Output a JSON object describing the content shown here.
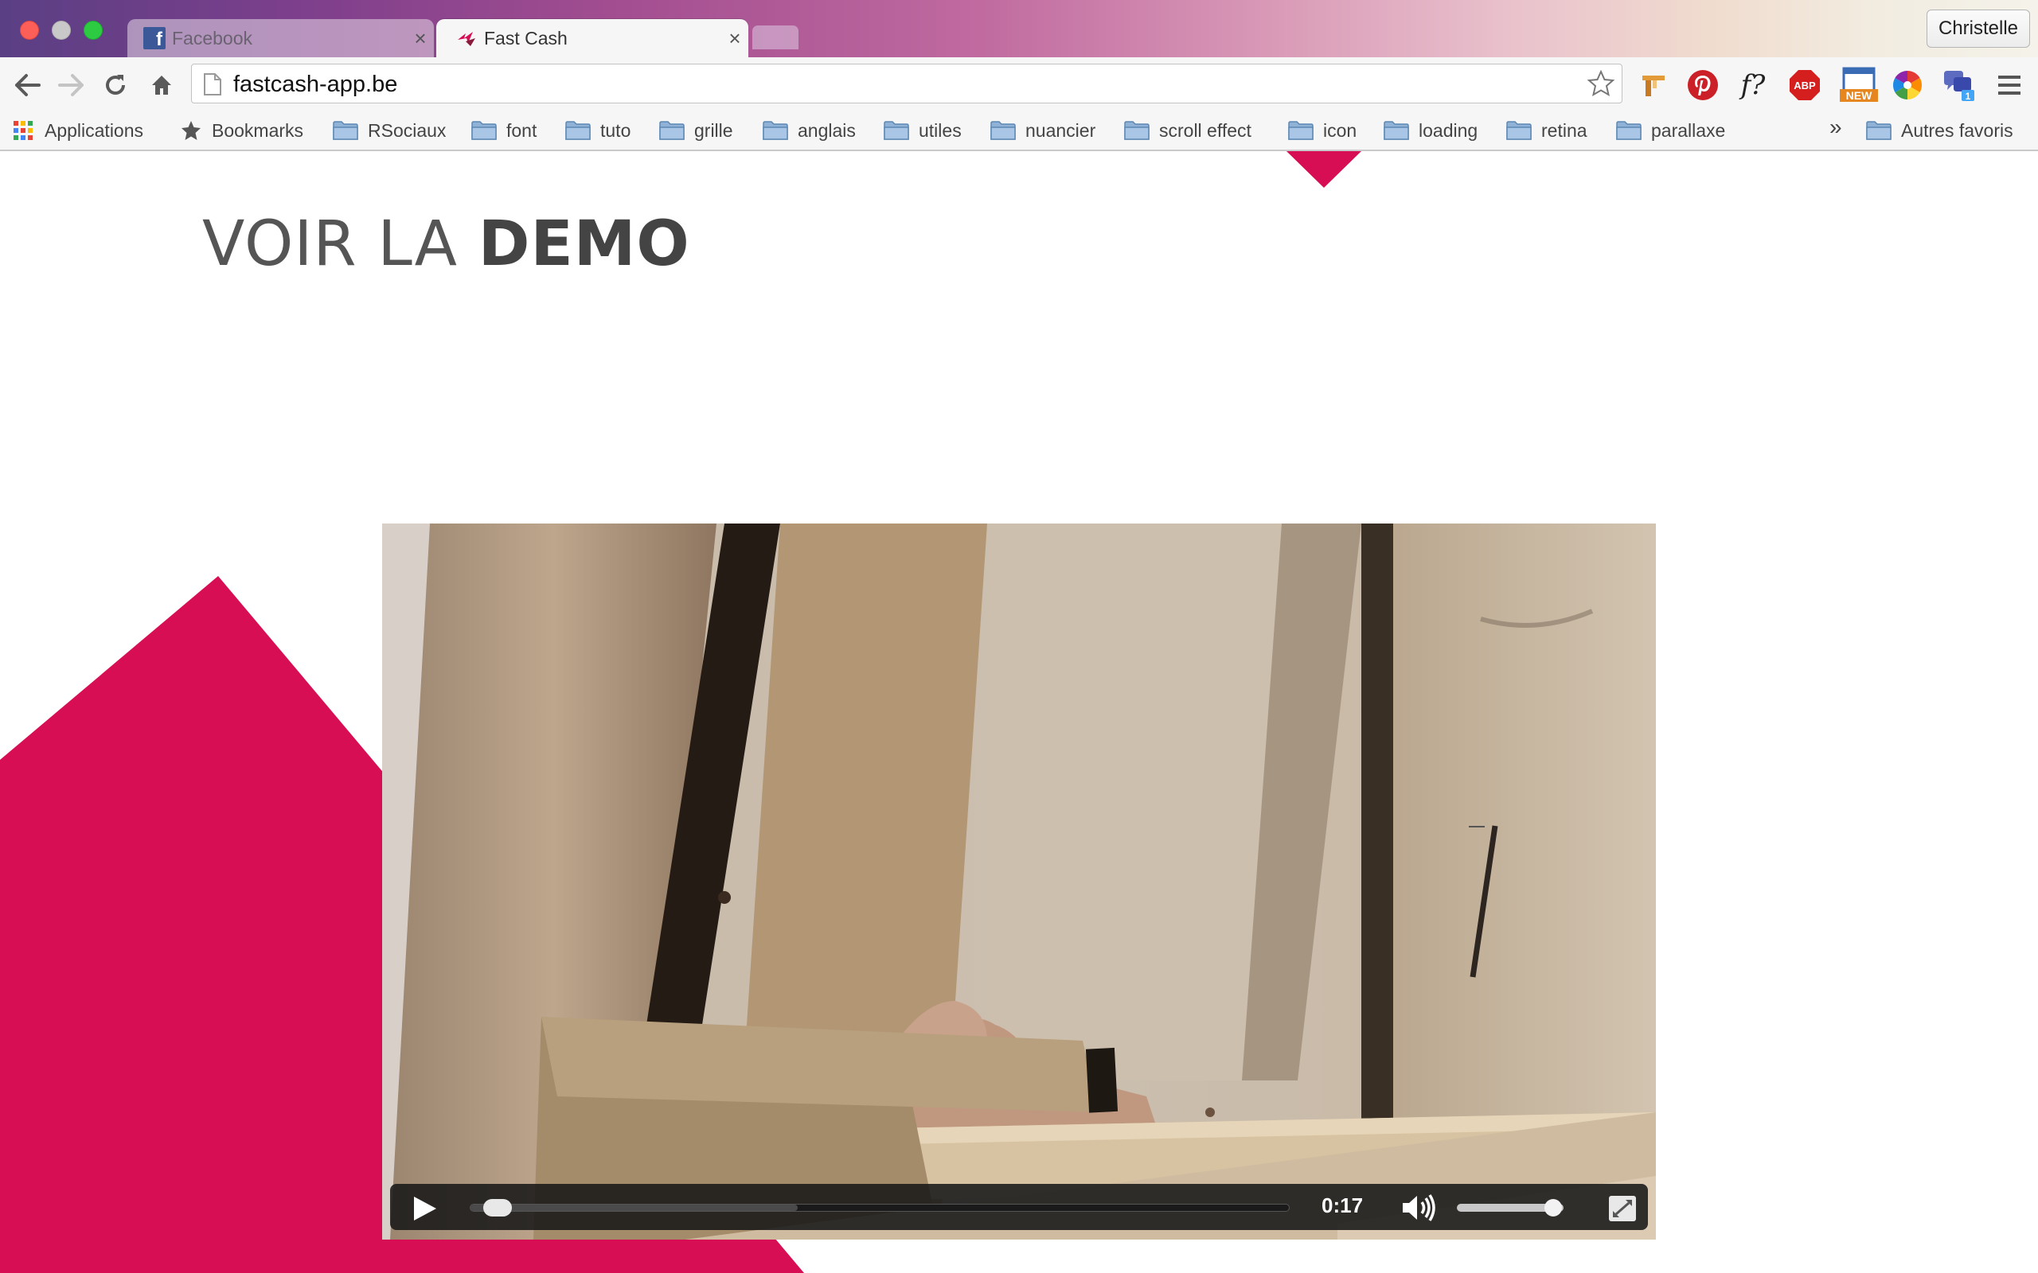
{
  "window": {
    "traffic_lights": [
      "close",
      "minimize",
      "zoom"
    ],
    "profile_name": "Christelle"
  },
  "tabs": [
    {
      "title": "Facebook",
      "icon": "facebook-icon",
      "close": "×",
      "active": false
    },
    {
      "title": "Fast Cash",
      "icon": "fastcash-logo-icon",
      "close": "×",
      "active": true
    }
  ],
  "toolbar": {
    "url": "fastcash-app.be",
    "nav_icons": [
      "back-arrow-icon",
      "forward-arrow-icon",
      "reload-icon",
      "home-icon"
    ],
    "extensions": [
      "bookmark-manager-icon",
      "pinterest-icon",
      "whatfont-icon",
      "adblock-plus-icon",
      "new-tab-extension-icon",
      "color-picker-icon",
      "translate-extension-icon",
      "chrome-menu-icon"
    ],
    "whatfont_label": "f?",
    "abp_label": "ABP",
    "new_label": "NEW",
    "translate_badge": "1"
  },
  "bookmarks": {
    "apps_label": "Applications",
    "bookmarks_label": "Bookmarks",
    "folders": [
      "RSociaux",
      "font",
      "tuto",
      "grille",
      "anglais",
      "utiles",
      "nuancier",
      "scroll effect",
      "icon",
      "loading",
      "retina",
      "parallaxe"
    ],
    "overflow": "»",
    "other": "Autres favoris"
  },
  "page": {
    "heading_light": "VOIR LA ",
    "heading_bold": "DEMO",
    "accent_color": "#d80e55"
  },
  "video": {
    "current_time": "0:17",
    "progress_fraction": 0.02,
    "buffered_fraction": 0.4,
    "volume_fraction": 0.9,
    "icons": [
      "play-icon",
      "volume-icon",
      "fullscreen-icon"
    ]
  }
}
